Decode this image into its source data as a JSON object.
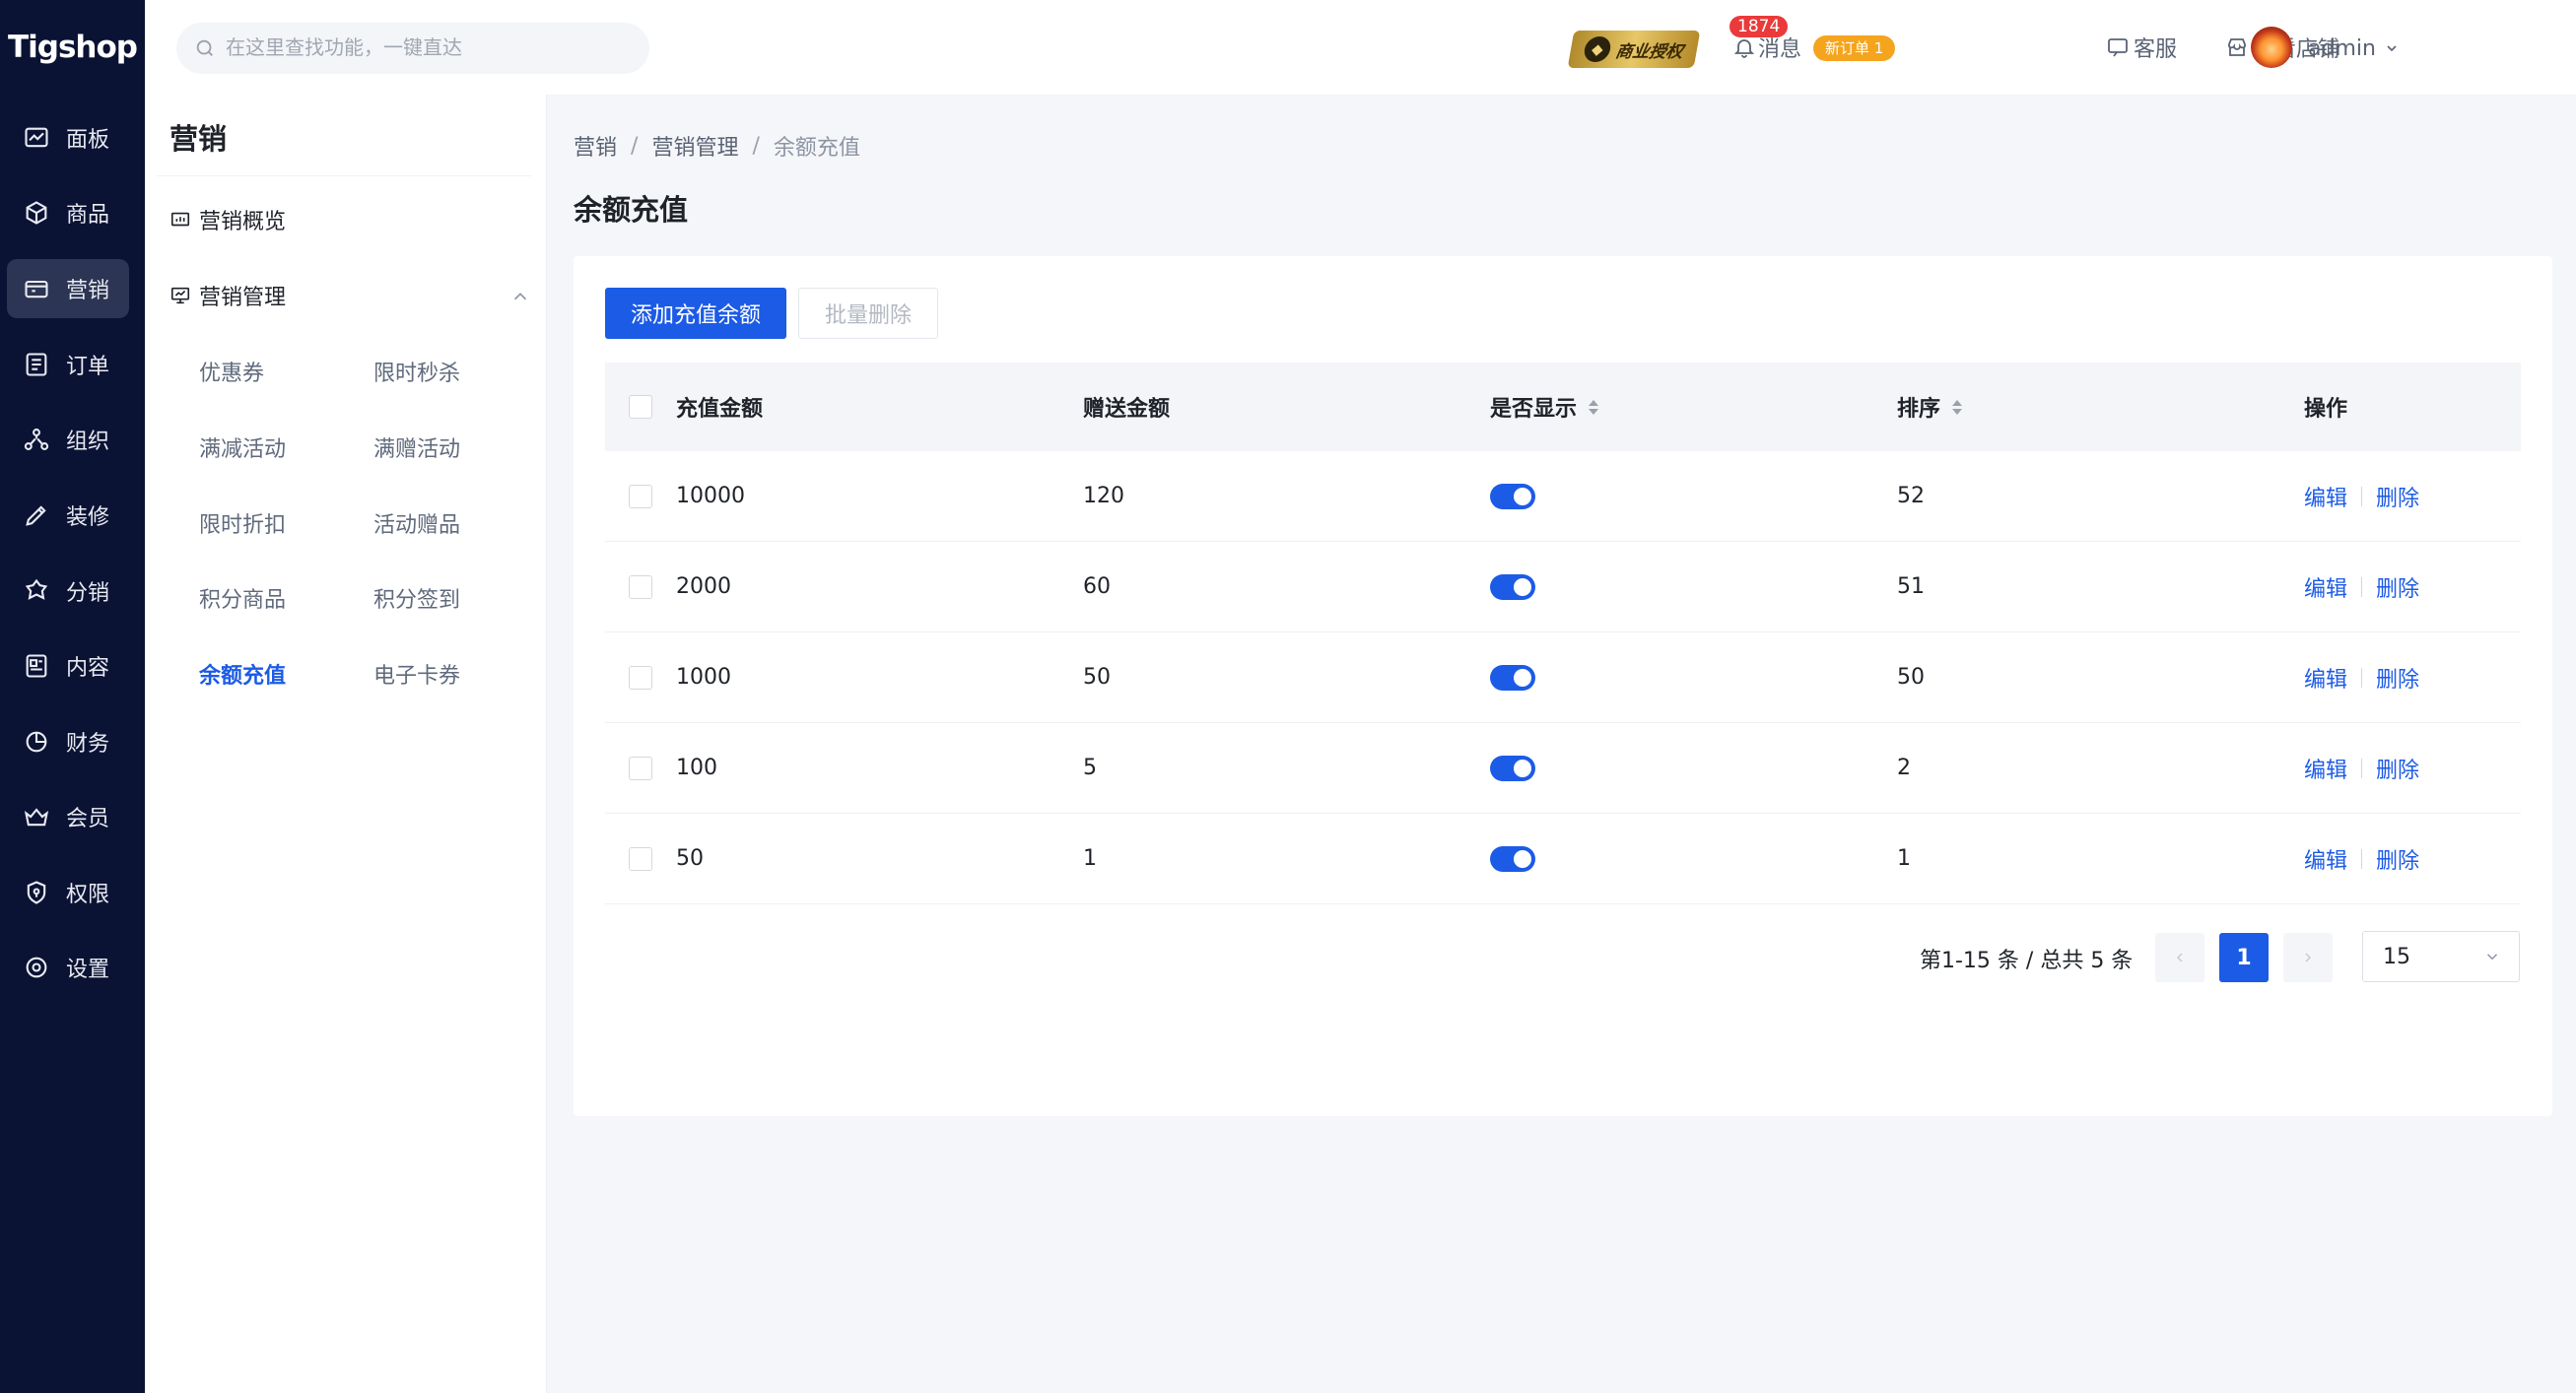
{
  "app": {
    "logo": "Tigshop"
  },
  "nav": {
    "items": [
      {
        "label": "面板",
        "icon": "dashboard-icon"
      },
      {
        "label": "商品",
        "icon": "box-icon"
      },
      {
        "label": "营销",
        "icon": "marketing-icon",
        "active": true
      },
      {
        "label": "订单",
        "icon": "order-icon"
      },
      {
        "label": "组织",
        "icon": "org-icon"
      },
      {
        "label": "装修",
        "icon": "decorate-icon"
      },
      {
        "label": "分销",
        "icon": "distribution-icon"
      },
      {
        "label": "内容",
        "icon": "content-icon"
      },
      {
        "label": "财务",
        "icon": "finance-icon"
      },
      {
        "label": "会员",
        "icon": "member-icon"
      },
      {
        "label": "权限",
        "icon": "permission-icon"
      },
      {
        "label": "设置",
        "icon": "settings-icon"
      }
    ]
  },
  "submenu": {
    "title": "营销",
    "overview": "营销概览",
    "group": "营销管理",
    "leaves": [
      {
        "label": "优惠券"
      },
      {
        "label": "限时秒杀"
      },
      {
        "label": "满减活动"
      },
      {
        "label": "满赠活动"
      },
      {
        "label": "限时折扣"
      },
      {
        "label": "活动赠品"
      },
      {
        "label": "积分商品"
      },
      {
        "label": "积分签到"
      },
      {
        "label": "余额充值",
        "active": true
      },
      {
        "label": "电子卡券"
      }
    ]
  },
  "topbar": {
    "search_placeholder": "在这里查找功能，一键直达",
    "license": "商业授权",
    "message_label": "消息",
    "message_count": "1874",
    "new_order": "新订单 1",
    "service": "客服",
    "view_store": "查看店铺",
    "user": "admin"
  },
  "breadcrumb": {
    "l1": "营销",
    "l2": "营销管理",
    "l3": "余额充值",
    "sep": "/"
  },
  "page_title": "余额充值",
  "toolbar": {
    "add": "添加充值余额",
    "batch_delete": "批量删除"
  },
  "table": {
    "headers": {
      "amount": "充值金额",
      "bonus": "赠送金额",
      "show": "是否显示",
      "sort": "排序",
      "ops": "操作"
    },
    "rows": [
      {
        "amount": "10000",
        "bonus": "120",
        "show": true,
        "sort": "52"
      },
      {
        "amount": "2000",
        "bonus": "60",
        "show": true,
        "sort": "51"
      },
      {
        "amount": "1000",
        "bonus": "50",
        "show": true,
        "sort": "50"
      },
      {
        "amount": "100",
        "bonus": "5",
        "show": true,
        "sort": "2"
      },
      {
        "amount": "50",
        "bonus": "1",
        "show": true,
        "sort": "1"
      }
    ],
    "edit": "编辑",
    "delete": "删除"
  },
  "pagination": {
    "summary": "第1-15 条 / 总共 5 条",
    "current": "1",
    "page_size": "15"
  },
  "colors": {
    "primary": "#1c5be6",
    "nav_bg": "#0b1334",
    "badge": "#ea3a3a",
    "new_order": "#f5a41e"
  }
}
